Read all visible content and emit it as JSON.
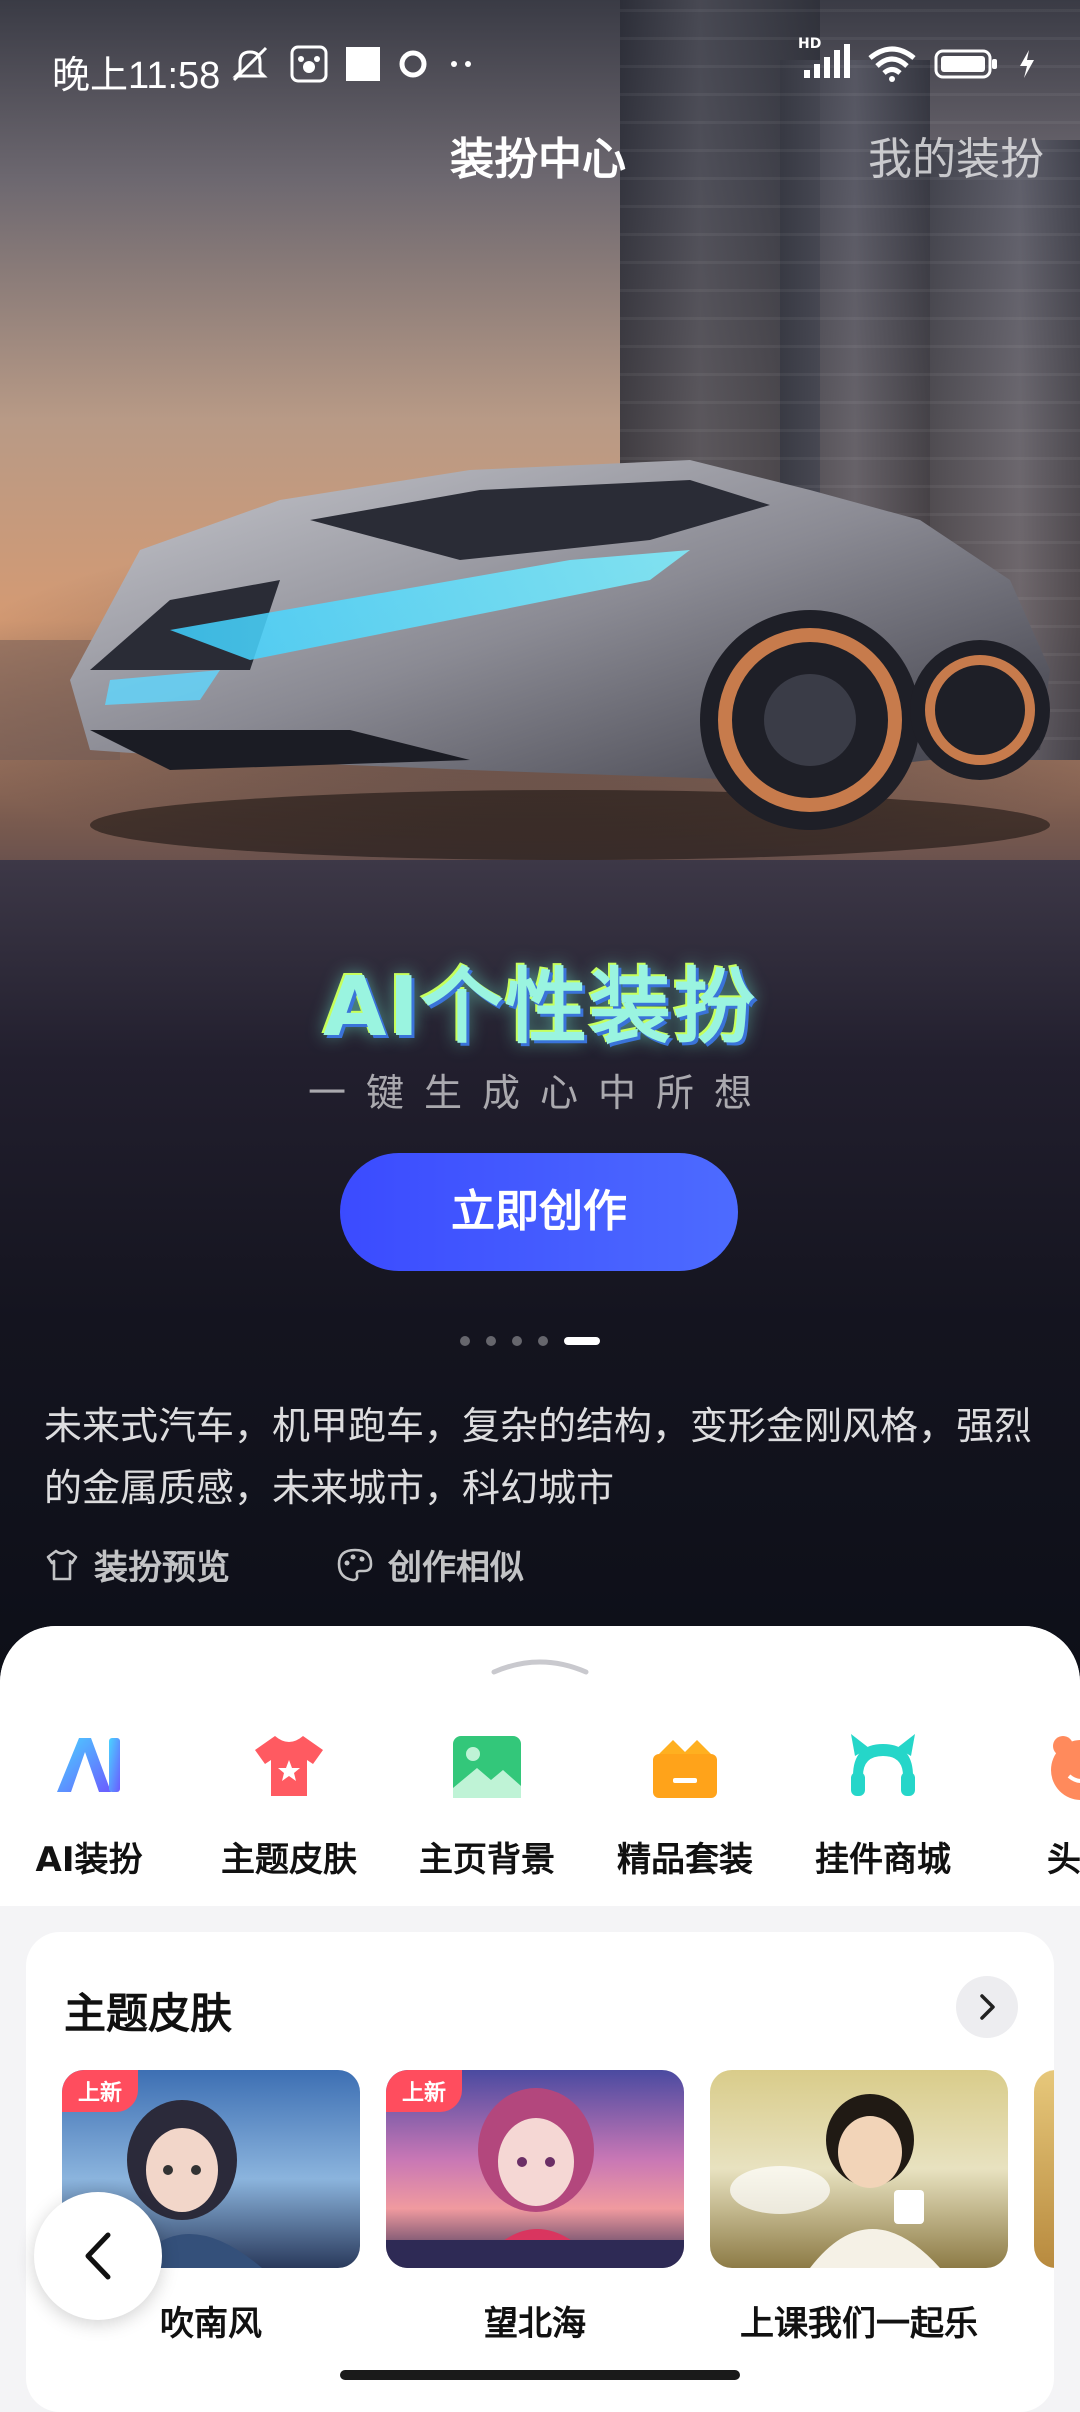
{
  "status_bar": {
    "time": "晚上11:58",
    "network": "HD"
  },
  "top_tabs": {
    "active": "装扮中心",
    "inactive": "我的装扮"
  },
  "banner": {
    "title": "AI个性装扮",
    "subtitle": "一键生成心中所想",
    "cta": "立即创作",
    "slides_total": 5,
    "active_slide": 5
  },
  "prompt": {
    "text": "未来式汽车，机甲跑车，复杂的结构，变形金刚风格，强烈的金属质感，未来城市，科幻城市",
    "actions": [
      "装扮预览",
      "创作相似"
    ]
  },
  "categories": [
    {
      "label": "AI装扮",
      "icon": "ai-icon"
    },
    {
      "label": "主题皮肤",
      "icon": "tshirt-icon"
    },
    {
      "label": "主页背景",
      "icon": "image-icon"
    },
    {
      "label": "精品套装",
      "icon": "crown-box-icon"
    },
    {
      "label": "挂件商城",
      "icon": "cat-ears-icon"
    },
    {
      "label": "头像",
      "icon": "avatar-icon"
    }
  ],
  "theme_section": {
    "title": "主题皮肤",
    "items": [
      {
        "name": "吹南风",
        "badge": "上新"
      },
      {
        "name": "望北海",
        "badge": "上新"
      },
      {
        "name": "上课我们一起乐",
        "badge": ""
      }
    ]
  },
  "colors": {
    "cta": "#4356ff",
    "badge": "#ff4d5e"
  }
}
